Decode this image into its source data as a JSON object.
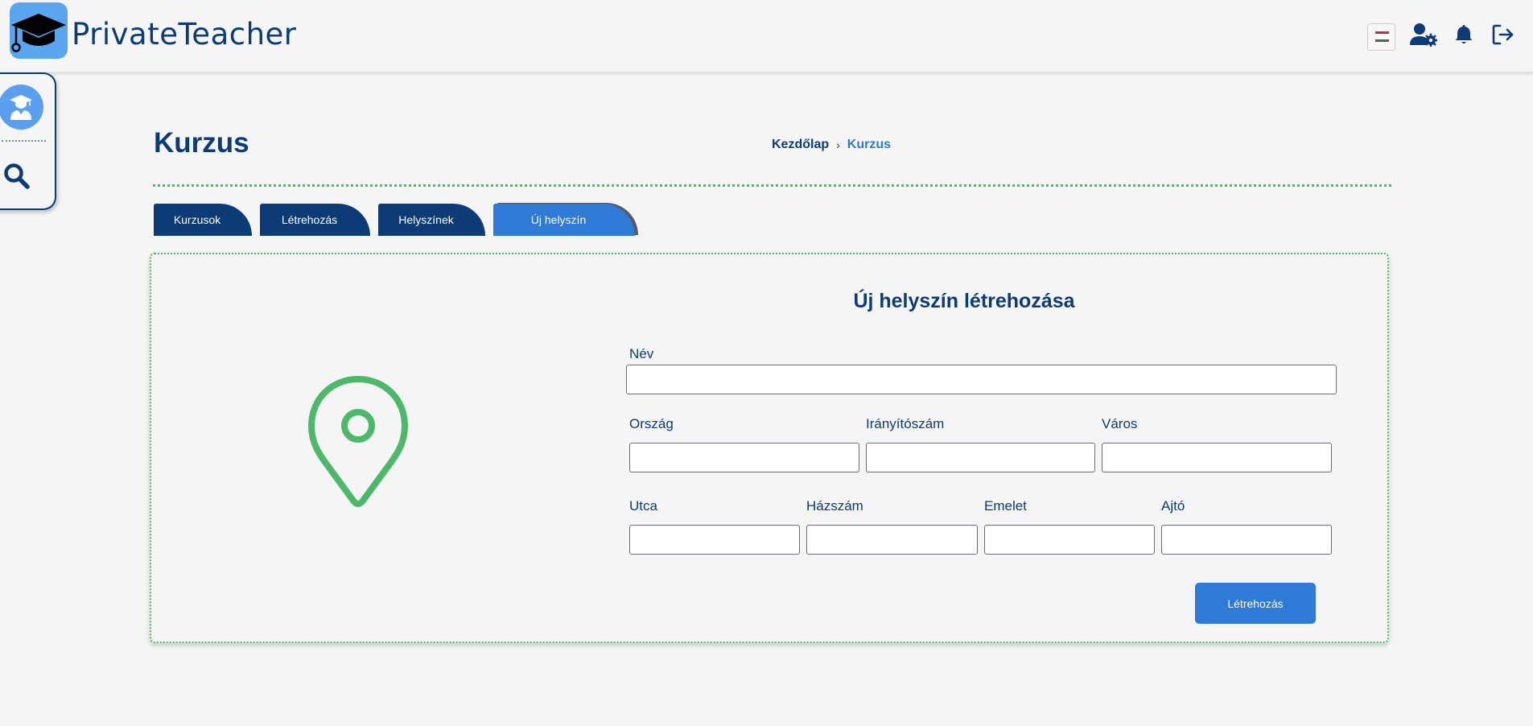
{
  "app": {
    "name": "PrivateTeacher"
  },
  "header": {
    "icons": [
      "hungarian-flag-icon",
      "user-settings-icon",
      "bell-icon",
      "logout-icon"
    ],
    "flag_colors": [
      "#cd2a3e",
      "#ffffff",
      "#436f4d"
    ]
  },
  "sidebar": {
    "items": [
      {
        "icon": "student-avatar-icon"
      },
      {
        "icon": "search-icon"
      }
    ]
  },
  "page": {
    "title": "Kurzus",
    "breadcrumb": {
      "home": "Kezdőlap",
      "separator": "›",
      "current": "Kurzus"
    }
  },
  "tabs": [
    {
      "label": "Kurzusok",
      "active": false
    },
    {
      "label": "Létrehozás",
      "active": false
    },
    {
      "label": "Helyszínek",
      "active": false
    },
    {
      "label": "Új helyszín",
      "active": true
    }
  ],
  "form": {
    "title": "Új helyszín létrehozása",
    "fields": {
      "nev": {
        "label": "Név",
        "value": ""
      },
      "orszag": {
        "label": "Ország",
        "value": ""
      },
      "iranyitoszam": {
        "label": "Irányítószám",
        "value": ""
      },
      "varos": {
        "label": "Város",
        "value": ""
      },
      "utca": {
        "label": "Utca",
        "value": ""
      },
      "hazszam": {
        "label": "Házszám",
        "value": ""
      },
      "emelet": {
        "label": "Emelet",
        "value": ""
      },
      "ajto": {
        "label": "Ajtó",
        "value": ""
      }
    },
    "submit_label": "Létrehozás"
  },
  "colors": {
    "primary": "#0d3b75",
    "accent": "#2f7ad7",
    "green": "#4cb86a",
    "background": "#f4f5f4"
  }
}
